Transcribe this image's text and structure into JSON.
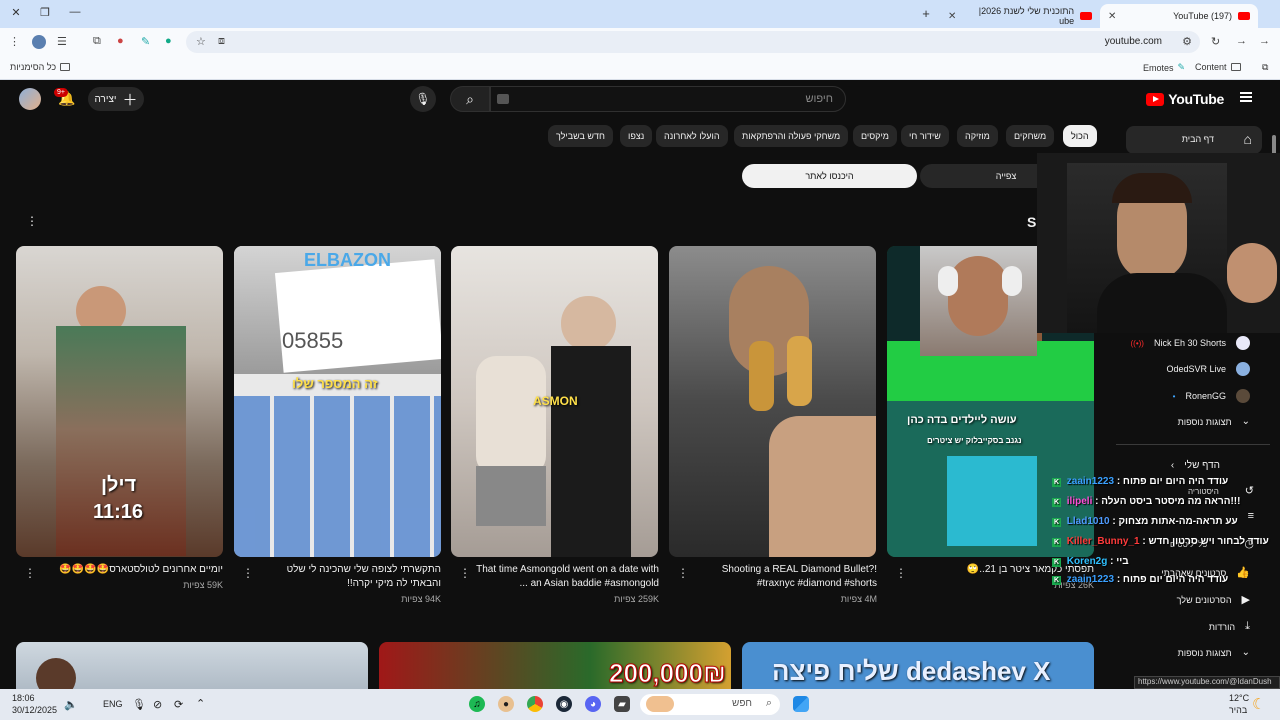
{
  "browser": {
    "tabs": [
      {
        "title": "(197) YouTube",
        "active": true
      },
      {
        "title": "התוכנית שלי לשנת 2026| ube",
        "active": false
      }
    ],
    "url": "youtube.com",
    "bookmarks": {
      "left_folder": "כל הסימניות",
      "right_items": [
        "Emotes",
        "Content"
      ]
    }
  },
  "youtube": {
    "logo_text": "YouTube",
    "search_placeholder": "חיפוש",
    "create_label": "יצירה",
    "notif_count": "9+",
    "chips": [
      "הכול",
      "משחקים",
      "מוזיקה",
      "שידור חי",
      "מיקסים",
      "משחקי פעולה והרפתקאות",
      "הועלו לאחרונה",
      "נצפו",
      "חדש בשבילך"
    ],
    "segment_left": "היכנסו לאתר",
    "segment_right": "צפייה",
    "shorts": [
      {
        "title": "יומיים אחרונים לטולסטארס🤩🤩🤩🤩",
        "views": "59K צפיות",
        "overlay_1": "דילן",
        "overlay_2": "11:16"
      },
      {
        "title": "התקשרתי לצופה שלי שהכינה לי שלט והבאתי לה מיקי יקרה!!",
        "views": "94K צפיות",
        "overlay_1": "ELBAZON",
        "overlay_2": "05855",
        "overlay_3": "זה המספר שלו"
      },
      {
        "title": "That time Asmongold went on a date with an Asian baddie #asmongold ...",
        "views": "259K צפיות",
        "overlay_1": "ASMON"
      },
      {
        "title": "Shooting a REAL Diamond Bullet?! #traxnyc #diamond #shorts",
        "views": "4M צפיות"
      },
      {
        "title": "תפסתי כקמאר ציטר בן 21..🙄",
        "views": "26K צפיות",
        "overlay_1": "עושה ליילדים בדה כהן",
        "overlay_2": "נגנב בסקייבלוק יש ציטרים"
      }
    ],
    "lower_thumbs": [
      {
        "overlay": ""
      },
      {
        "overlay": "200,000₪"
      },
      {
        "overlay": "dedashev X שליח פיצה"
      }
    ],
    "sidebar": {
      "home": "דף הבית",
      "subs": [
        {
          "name": "Nick Eh 30 Shorts"
        },
        {
          "name": "OdedSVR Live"
        },
        {
          "name": "RonenGG"
        }
      ],
      "show_more_1": "תצוגות נוספות",
      "you_header": "הדף שלי",
      "you_items": [
        "היסטוריה",
        "פלייליסטים",
        "סרטונים שאהבתי",
        "הסרטונים שלך",
        "הורדות"
      ],
      "show_more_2": "תצוגות נוספות"
    }
  },
  "stream_chat": [
    {
      "user": "zaain1223",
      "msg": "עודד היה היום יום פתוח :",
      "color": "#3aa0ff"
    },
    {
      "user": "ilipeli",
      "msg": "!!!הראה מה מיסטר ביסט העלה :",
      "color": "#ff4fd8"
    },
    {
      "user": "Llad1010",
      "msg": "עע תראה-מה-אתות מצחוק :",
      "color": "#4f9bff"
    },
    {
      "user": "Killer_Bunny_1",
      "msg": "עודד לבחור ויש סרטון חדש :",
      "color": "#ff3b3b"
    },
    {
      "user": "Koren2g",
      "msg": "ביי :",
      "color": "#2fc0ff"
    },
    {
      "user": "zaain1223",
      "msg": "עודד היה היום יום פתוח :",
      "color": "#3aa0ff"
    }
  ],
  "status_bar_url": "https://www.youtube.com/@IdanDush",
  "taskbar": {
    "time": "18:06",
    "date": "30/12/2025",
    "lang": "ENG",
    "search_placeholder": "חפש",
    "weather_temp": "12°C",
    "weather_desc": "בהיר"
  }
}
